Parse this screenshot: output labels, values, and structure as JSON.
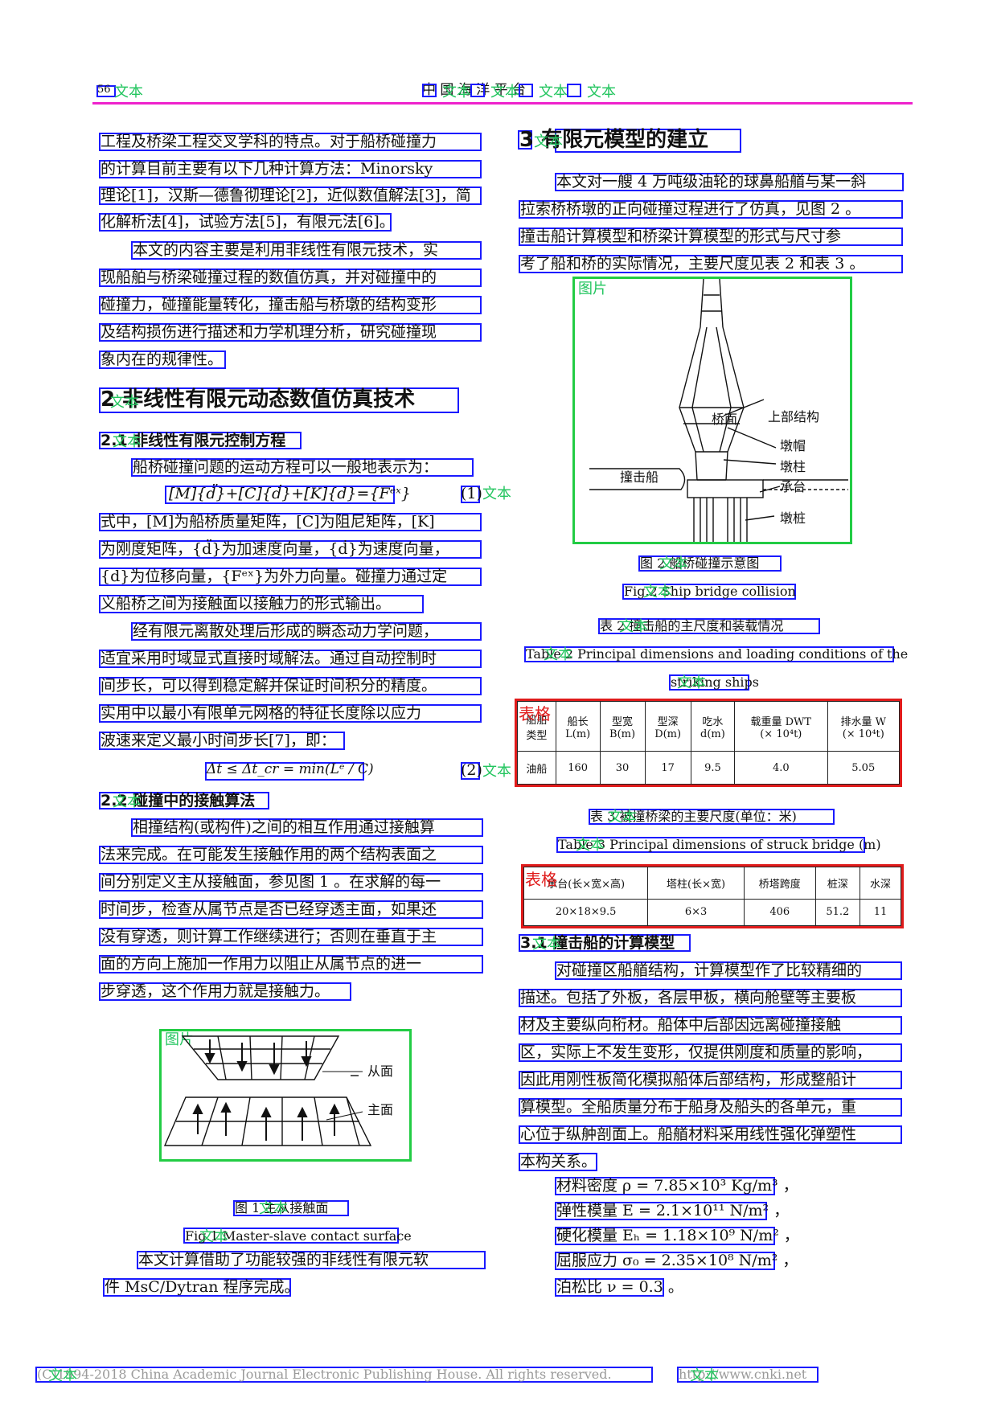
{
  "colors": {
    "text_box": "#1a1aff",
    "figure_box": "#22cc44",
    "table_box": "#e01b1b",
    "header_rule": "#ee22cc"
  },
  "region_labels": {
    "text": "文本",
    "figure": "图片",
    "table": "表格"
  },
  "header": {
    "page_number": "56",
    "journal_title": "中 国 海 洋 平 台"
  },
  "left": {
    "para1": [
      "工程及桥梁工程交叉学科的特点。对于船桥碰撞力",
      "的计算目前主要有以下几种计算方法：Minorsky",
      "理论[1]，汉斯—德鲁彻理论[2]，近似数值解法[3]，简",
      "化解析法[4]，试验方法[5]，有限元法[6]。"
    ],
    "para2": [
      "本文的内容主要是利用非线性有限元技术，实",
      "现船舶与桥梁碰撞过程的数值仿真，并对碰撞中的",
      "碰撞力，碰撞能量转化，撞击船与桥墩的结构变形",
      "及结构损伤进行描述和力学机理分析，研究碰撞现",
      "象内在的规律性。"
    ],
    "sec2": "2  非线性有限元动态数值仿真技术",
    "sec21": "2.1  非线性有限元控制方程",
    "para3": "船桥碰撞问题的运动方程可以一般地表示为：",
    "eq1": "[M]{d̈}+[C]{ḋ}+[K]{d}={Fᵉˣ}",
    "eq1_no": "(1)",
    "para4": [
      "式中，[M]为船桥质量矩阵，[C]为阻尼矩阵，[K]",
      "为刚度矩阵，{d̈}为加速度向量，{ḋ}为速度向量，",
      "{d}为位移向量，{Fᵉˣ}为外力向量。碰撞力通过定",
      "义船桥之间为接触面以接触力的形式输出。"
    ],
    "para5": [
      "经有限元离散处理后形成的瞬态动力学问题，",
      "适宜采用时域显式直接时域解法。通过自动控制时",
      "间步长，可以得到稳定解并保证时间积分的精度。",
      "实用中以最小有限单元网格的特征长度除以应力",
      "波速来定义最小时间步长[7]，即："
    ],
    "eq2": "Δt ≤ Δt_cr = min(Lᵉ / C)",
    "eq2_no": "(2)",
    "sec22": "2.2  碰撞中的接触算法",
    "para6": [
      "相撞结构(或构件)之间的相互作用通过接触算",
      "法来完成。在可能发生接触作用的两个结构表面之",
      "间分别定义主从接触面，参见图 1 。在求解的每一",
      "时间步，检查从属节点是否已经穿透主面，如果还",
      "没有穿透，则计算工作继续进行；否则在垂直于主",
      "面的方向上施加一作用力以阻止从属节点的进一",
      "步穿透，这个作用力就是接触力。"
    ],
    "fig1": {
      "slave": "从面",
      "master": "主面"
    },
    "fig1_cap_cn": "图 1  主从接触面",
    "fig1_cap_en": "Fig.1   Master-slave contact surface",
    "para7": [
      "本文计算借助了功能较强的非线性有限元软",
      "件 MsC/Dytran 程序完成。"
    ]
  },
  "right": {
    "sec3": "3  有限元模型的建立",
    "para1": [
      "本文对一艘 4 万吨级油轮的球鼻船艏与某一斜",
      "拉索桥桥墩的正向碰撞过程进行了仿真，见图 2 。",
      "撞击船计算模型和桥梁计算模型的形式与尺寸参",
      "考了船和桥的实际情况，主要尺度见表 2 和表 3 。"
    ],
    "fig2": {
      "deck": "桥面",
      "upper": "上部结构",
      "cap": "墩帽",
      "column": "墩柱",
      "ship": "撞击船",
      "platform": "承台",
      "pile": "墩桩"
    },
    "fig2_cap_cn": "图 2  船桥碰撞示意图",
    "fig2_cap_en": "Fig.2   Ship bridge collision",
    "tab2_cap_cn": "表 2  撞击船的主尺度和装载情况",
    "tab2_cap_en_1": "Table 2    Principal dimensions and loading conditions of the",
    "tab2_cap_en_2": "striking ships",
    "tab2": {
      "header": [
        "船舶\n类型",
        "船长\nL(m)",
        "型宽\nB(m)",
        "型深\nD(m)",
        "吃水\nd(m)",
        "载重量 DWT\n(× 10⁴t)",
        "排水量 W\n(× 10⁴t)"
      ],
      "row": [
        "油船",
        "160",
        "30",
        "17",
        "9.5",
        "4.0",
        "5.05"
      ]
    },
    "tab3_cap_cn": "表 3  被撞桥梁的主要尺度(单位：米)",
    "tab3_cap_en": "Table 3    Principal dimensions of struck bridge (m)",
    "tab3": {
      "header": [
        "承台(长×宽×高)",
        "塔柱(长×宽)",
        "桥塔跨度",
        "桩深",
        "水深"
      ],
      "row": [
        "20×18×9.5",
        "6×3",
        "406",
        "51.2",
        "11"
      ]
    },
    "sec31": "3.1  撞击船的计算模型",
    "para2": [
      "对碰撞区船艏结构，计算模型作了比较精细的",
      "描述。包括了外板，各层甲板，横向舱壁等主要板",
      "材及主要纵向桁材。船体中后部因远离碰撞接触",
      "区，实际上不发生变形，仅提供刚度和质量的影响，",
      "因此用刚性板简化模拟船体后部结构，形成整船计",
      "算模型。全船质量分布于船身及船头的各单元，重",
      "心位于纵舯剖面上。船艏材料采用线性强化弹塑性",
      "本构关系。"
    ],
    "props": [
      "材料密度 ρ = 7.85×10³ Kg/m³ ，",
      "弹性模量 E = 2.1×10¹¹ N/m² ，",
      "硬化模量 Eₕ = 1.18×10⁹ N/m² ，",
      "屈服应力 σ₀ = 2.35×10⁸ N/m² ，",
      "泊松比 ν = 0.3 。"
    ]
  },
  "footer": {
    "copyright": "(C)1994-2018 China Academic Journal Electronic Publishing House. All rights reserved.",
    "url": "http://www.cnki.net"
  }
}
